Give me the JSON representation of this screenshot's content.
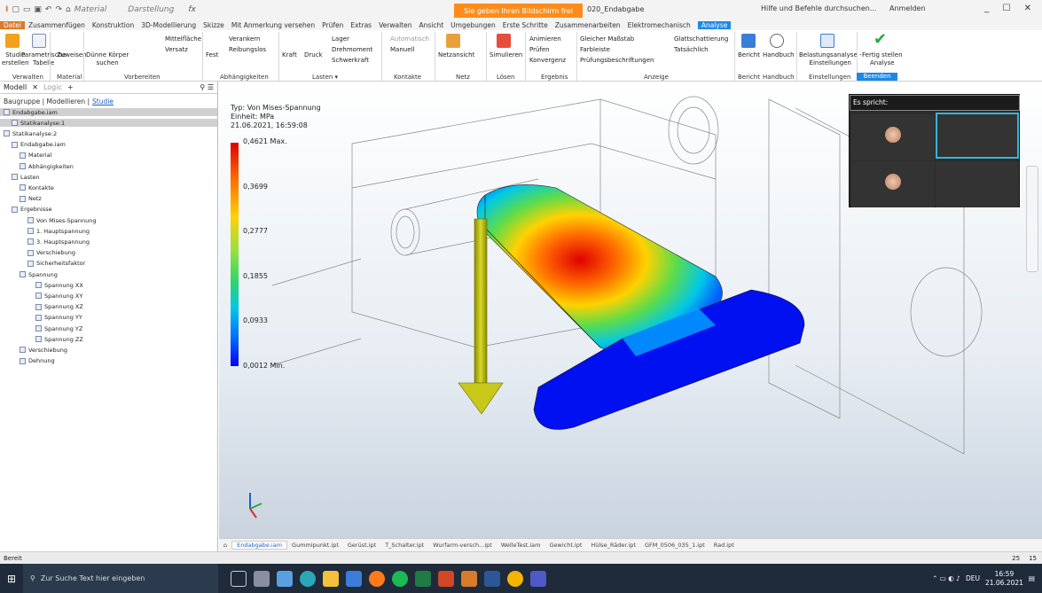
{
  "titlebar": {
    "material": "Material",
    "darstellung": "Darstellung",
    "share_banner": "Sie geben Ihren Bildschirm frei",
    "doc_title": "020_Endabgabe",
    "help_search": "Hilfe und Befehle durchsuchen...",
    "signin": "Anmelden",
    "window_controls": "_ ☐ ✕"
  },
  "menubar": {
    "tabs": [
      "Datei",
      "Zusammenfügen",
      "Konstruktion",
      "3D-Modellierung",
      "Skizze",
      "Mit Anmerkung versehen",
      "Prüfen",
      "Extras",
      "Verwalten",
      "Ansicht",
      "Umgebungen",
      "Erste Schritte",
      "Zusammenarbeiten",
      "Elektromechanisch",
      "Analyse"
    ]
  },
  "ribbon": {
    "items": {
      "studie": "Studie\nerstellen",
      "parametrische": "Parametrische\nTabelle",
      "zuweisen": "Zuweisen",
      "duenne": "Dünne Körper\nsuchen",
      "mittelflaeche": "Mittelfläche",
      "versatz": "Versatz",
      "fest": "Fest",
      "verankern": "Verankern",
      "reibungslos": "Reibungslos",
      "lager": "Lager",
      "kraft": "Kraft",
      "druck": "Druck",
      "drehmoment": "Drehmoment",
      "schwerkraft": "Schwerkraft",
      "automatisch": "Automatisch",
      "manuell": "Manuell",
      "netzansicht": "Netzansicht",
      "simulieren": "Simulieren",
      "animieren": "Animieren",
      "pruefen": "Prüfen",
      "konvergenz": "Konvergenz",
      "gleicher": "Gleicher Maßstab",
      "farbleiste": "Farbleiste",
      "pruefungsbeschriftungen": "Prüfungsbeschriftungen",
      "glattschattierung": "Glattschattierung",
      "tatsaechlich": "Tatsächlich",
      "bericht": "Bericht",
      "handbuch": "Handbuch",
      "belastung": "Belastungsanalyse -\nEinstellungen",
      "fertig": "Fertig stellen\nAnalyse"
    },
    "groups": {
      "verwalten": "Verwalten",
      "material": "Material",
      "vorbereiten": "Vorbereiten",
      "abhaengigkeiten": "Abhängigkeiten",
      "lasten": "Lasten ▾",
      "kontakte": "Kontakte",
      "netz": "Netz",
      "loesen": "Lösen",
      "ergebnis": "Ergebnis",
      "anzeige": "Anzeige",
      "bericht": "Bericht",
      "handbuch": "Handbuch",
      "einstellungen": "Einstellungen",
      "beenden": "Beenden"
    }
  },
  "leftpanel": {
    "header": "Modell",
    "close": "✕",
    "logic": "Logic",
    "add": "+",
    "tabs_prefix": "Baugruppe | Modellieren |",
    "tabs_active": "Studie",
    "tree": [
      {
        "label": "Endabgabe.iam",
        "indent": 0,
        "sel": true
      },
      {
        "label": "Statikanalyse:1",
        "indent": 1,
        "sel": true
      },
      {
        "label": "Statikanalyse:2",
        "indent": 0,
        "sel": false
      },
      {
        "label": "Endabgabe.iam",
        "indent": 1,
        "sel": false
      },
      {
        "label": "Material",
        "indent": 2,
        "sel": false
      },
      {
        "label": "Abhängigkeiten",
        "indent": 2,
        "sel": false
      },
      {
        "label": "Lasten",
        "indent": 1,
        "sel": false
      },
      {
        "label": "Kontakte",
        "indent": 2,
        "sel": false
      },
      {
        "label": "Netz",
        "indent": 2,
        "sel": false
      },
      {
        "label": "Ergebnisse",
        "indent": 1,
        "sel": false
      },
      {
        "label": "Von Mises-Spannung",
        "indent": 3,
        "sel": false
      },
      {
        "label": "1. Hauptspannung",
        "indent": 3,
        "sel": false
      },
      {
        "label": "3. Hauptspannung",
        "indent": 3,
        "sel": false
      },
      {
        "label": "Verschiebung",
        "indent": 3,
        "sel": false
      },
      {
        "label": "Sicherheitsfaktor",
        "indent": 3,
        "sel": false
      },
      {
        "label": "Spannung",
        "indent": 2,
        "sel": false
      },
      {
        "label": "Spannung XX",
        "indent": 4,
        "sel": false
      },
      {
        "label": "Spannung XY",
        "indent": 4,
        "sel": false
      },
      {
        "label": "Spannung XZ",
        "indent": 4,
        "sel": false
      },
      {
        "label": "Spannung YY",
        "indent": 4,
        "sel": false
      },
      {
        "label": "Spannung YZ",
        "indent": 4,
        "sel": false
      },
      {
        "label": "Spannung ZZ",
        "indent": 4,
        "sel": false
      },
      {
        "label": "Verschiebung",
        "indent": 2,
        "sel": false
      },
      {
        "label": "Dehnung",
        "indent": 2,
        "sel": false
      }
    ]
  },
  "viewport": {
    "legend_type": "Typ: Von Mises-Spannung",
    "legend_unit": "Einheit: MPa",
    "legend_date": "21.06.2021, 16:59:08",
    "colorbar_levels": [
      "0,4621 Max.",
      "0,3699",
      "0,2777",
      "0,1855",
      "0,0933",
      "0,0012 Min."
    ]
  },
  "video": {
    "speaker_prefix": "Es spricht:"
  },
  "bottomtabs": [
    "Endabgabe.iam",
    "Gummipunkt.ipt",
    "Gerüst.ipt",
    "T_Schalter.ipt",
    "Wurfarm-versch...ipt",
    "WelleTest.iam",
    "Gewicht.ipt",
    "Hülse_Räder.ipt",
    "GFM_0506_035_1.ipt",
    "Rad.ipt"
  ],
  "statusbar": {
    "text": "Bereit",
    "n1": "25",
    "n2": "15"
  },
  "taskbar": {
    "search": "Zur Suche Text hier eingeben",
    "lang": "DEU",
    "time": "16:59",
    "date": "21.06.2021"
  },
  "colors": {
    "accent": "#1e88e5",
    "file_tab": "#d87b2c",
    "banner": "#ff8c1a",
    "taskbar": "#1f2a3a"
  }
}
